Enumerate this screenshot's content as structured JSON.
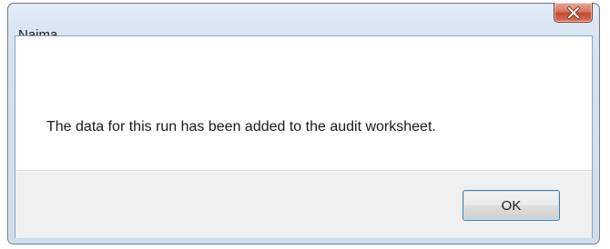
{
  "dialog": {
    "title": "Naima",
    "message": "The data for this run has been added to the audit worksheet.",
    "ok_label": "OK",
    "close_icon": "close-icon"
  },
  "colors": {
    "close_button": "#c7513a",
    "frame": "#d6e2ef",
    "button_border": "#3c7fb1"
  }
}
